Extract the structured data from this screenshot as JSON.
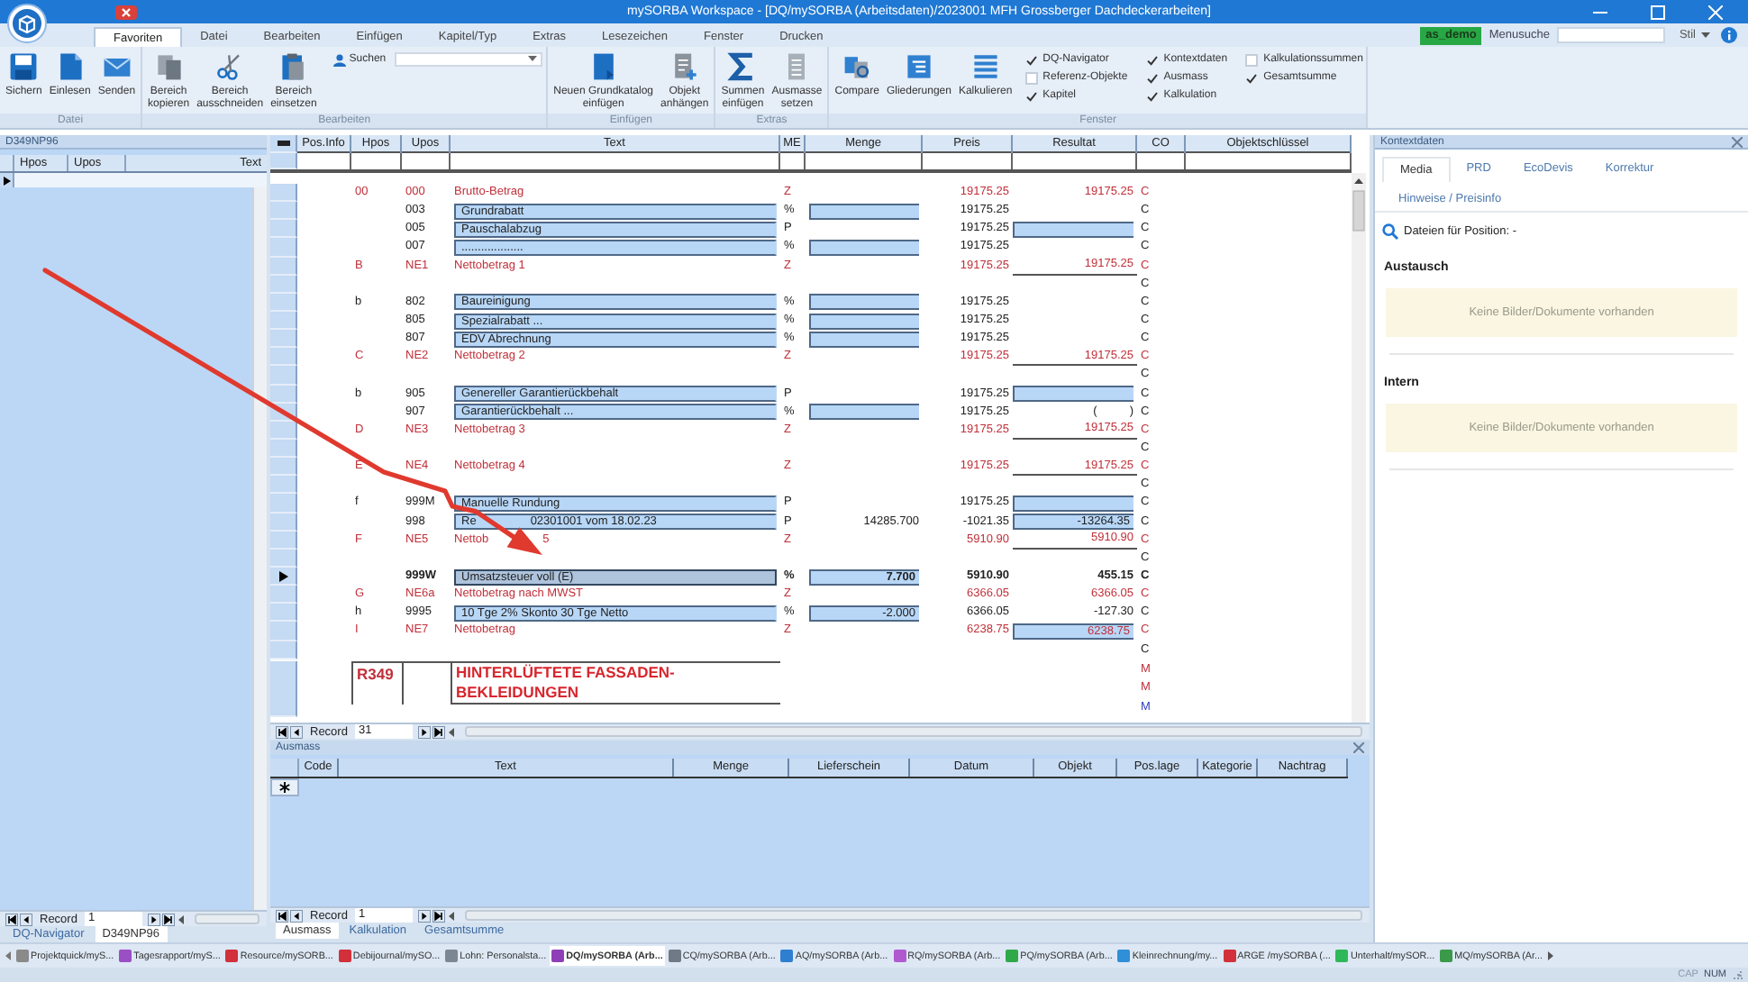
{
  "window": {
    "title": "mySORBA Workspace - [DQ/mySORBA (Arbeitsdaten)/2023001 MFH Grossberger Dachdeckerarbeiten]"
  },
  "menu_tabs": [
    {
      "label": "Favoriten",
      "selected": true
    },
    {
      "label": "Datei",
      "selected": false
    },
    {
      "label": "Bearbeiten",
      "selected": false
    },
    {
      "label": "Einfügen",
      "selected": false
    },
    {
      "label": "Kapitel/Typ",
      "selected": false
    },
    {
      "label": "Extras",
      "selected": false
    },
    {
      "label": "Lesezeichen",
      "selected": false
    },
    {
      "label": "Fenster",
      "selected": false
    },
    {
      "label": "Drucken",
      "selected": false
    }
  ],
  "user": "as_demo",
  "menu_search": {
    "label": "Menusuche"
  },
  "style_menu": "Stil",
  "ribbon_groups": [
    {
      "label": "Datei",
      "buttons": [
        {
          "label": "Sichern"
        },
        {
          "label": "Einlesen"
        },
        {
          "label": "Senden"
        }
      ]
    },
    {
      "label": "Bearbeiten",
      "buttons": [
        {
          "label": "Bereich\nkopieren"
        },
        {
          "label": "Bereich\nausschneiden"
        },
        {
          "label": "Bereich\neinsetzen"
        }
      ],
      "search": {
        "label": "Suchen"
      }
    },
    {
      "label": "Einfügen",
      "buttons": [
        {
          "label": "Neuen Grundkatalog\neinfügen"
        },
        {
          "label": "Objekt\nanhängen"
        }
      ]
    },
    {
      "label": "Extras",
      "buttons": [
        {
          "label": "Summen\neinfügen"
        },
        {
          "label": "Ausmasse\nsetzen"
        }
      ]
    },
    {
      "label": "Fenster",
      "buttons": [
        {
          "label": "Compare"
        },
        {
          "label": "Gliederungen"
        },
        {
          "label": "Kalkulieren"
        }
      ],
      "checkboxes": [
        {
          "label": "DQ-Navigator",
          "checked": true
        },
        {
          "label": "Referenz-Objekte",
          "checked": false
        },
        {
          "label": "Kapitel",
          "checked": true
        },
        {
          "label": "Kontextdaten",
          "checked": true
        },
        {
          "label": "Ausmass",
          "checked": true
        },
        {
          "label": "Kalkulation",
          "checked": true
        },
        {
          "label": "Kalkulationssummen",
          "checked": false
        },
        {
          "label": "Gesamtsumme",
          "checked": true
        }
      ]
    }
  ],
  "left_panel": {
    "title": "D349NP96",
    "columns": [
      "Hpos",
      "Upos",
      "Text"
    ],
    "record_nav": {
      "label": "Record",
      "value": "1"
    },
    "tabs": [
      {
        "label": "DQ-Navigator",
        "selected": false
      },
      {
        "label": "D349NP96",
        "selected": true
      }
    ]
  },
  "grid": {
    "columns": [
      "Pos.Info",
      "Hpos",
      "Upos",
      "Text",
      "ME",
      "Menge",
      "Preis",
      "Resultat",
      "CO",
      "Objektschlüssel"
    ],
    "rows": [
      {
        "kind": "total",
        "selected": false,
        "hpos": "00",
        "upos": "000",
        "text": "Brutto-Betrag",
        "me": "Z",
        "preis": "19175.25",
        "resultat": "19175.25",
        "co": "C"
      },
      {
        "kind": "input",
        "selected": false,
        "upos": "003",
        "text": "Grundrabatt",
        "me": "%",
        "menge_field": true,
        "preis": "19175.25",
        "co": "C"
      },
      {
        "kind": "input",
        "selected": false,
        "upos": "005",
        "text": "Pauschalabzug",
        "me": "P",
        "preis": "19175.25",
        "resultat_field": true,
        "co": "C"
      },
      {
        "kind": "input",
        "selected": false,
        "upos": "007",
        "text": "...................",
        "me": "%",
        "menge_field": true,
        "preis": "19175.25",
        "co": "C"
      },
      {
        "kind": "total",
        "selected": false,
        "hpos": "B",
        "upos": "NE1",
        "text": "Nettobetrag 1",
        "me": "Z",
        "preis": "19175.25",
        "resultat": "19175.25",
        "underlined": true,
        "co": "C"
      },
      {
        "kind": "blank",
        "selected": false,
        "co": "C"
      },
      {
        "kind": "input",
        "selected": false,
        "hpos": "b",
        "upos": "802",
        "text": "Baureinigung",
        "me": "%",
        "menge_field": true,
        "preis": "19175.25",
        "co": "C"
      },
      {
        "kind": "input",
        "selected": false,
        "upos": "805",
        "text": "Spezialrabatt ...",
        "me": "%",
        "menge_field": true,
        "preis": "19175.25",
        "co": "C"
      },
      {
        "kind": "input",
        "selected": false,
        "upos": "807",
        "text": "EDV Abrechnung",
        "me": "%",
        "menge_field": true,
        "preis": "19175.25",
        "co": "C"
      },
      {
        "kind": "total",
        "selected": false,
        "hpos": "C",
        "upos": "NE2",
        "text": "Nettobetrag 2",
        "me": "Z",
        "preis": "19175.25",
        "resultat": "19175.25",
        "underlined": true,
        "co": "C"
      },
      {
        "kind": "blank",
        "selected": false,
        "co": "C"
      },
      {
        "kind": "input",
        "selected": false,
        "hpos": "b",
        "upos": "905",
        "text": "Genereller Garantierückbehalt",
        "me": "P",
        "preis": "19175.25",
        "resultat_field": true,
        "co": "C"
      },
      {
        "kind": "input",
        "selected": false,
        "upos": "907",
        "text": "Garantierückbehalt ...",
        "me": "%",
        "menge_field": true,
        "preis": "19175.25",
        "resultat": "(          )",
        "co": "C"
      },
      {
        "kind": "total",
        "selected": false,
        "hpos": "D",
        "upos": "NE3",
        "text": "Nettobetrag 3",
        "me": "Z",
        "preis": "19175.25",
        "resultat": "19175.25",
        "underlined": true,
        "co": "C"
      },
      {
        "kind": "blank",
        "selected": false,
        "co": "C"
      },
      {
        "kind": "total",
        "selected": false,
        "hpos": "E",
        "upos": "NE4",
        "text": "Nettobetrag 4",
        "me": "Z",
        "preis": "19175.25",
        "resultat": "19175.25",
        "underlined": true,
        "co": "C"
      },
      {
        "kind": "blank",
        "selected": false,
        "co": "C"
      },
      {
        "kind": "input",
        "selected": false,
        "hpos": "f",
        "upos": "999M",
        "text": "Manuelle Rundung",
        "me": "P",
        "preis": "19175.25",
        "resultat_field": true,
        "co": "C"
      },
      {
        "kind": "input",
        "selected": false,
        "upos": "998",
        "text_pieces": [
          "Re",
          "02301001 vom 18.02.23"
        ],
        "me": "P",
        "menge": "14285.700",
        "preis": "-1021.35",
        "resultat": "-13264.35",
        "resultat_field": true,
        "co": "C"
      },
      {
        "kind": "total",
        "selected": false,
        "hpos": "F",
        "upos": "NE5",
        "text_pieces": [
          "Nettob",
          "5"
        ],
        "me": "Z",
        "preis": "5910.90",
        "resultat": "5910.90",
        "underlined": true,
        "co": "C"
      },
      {
        "kind": "blank",
        "selected": false,
        "co": "C"
      },
      {
        "kind": "current",
        "selected": true,
        "upos": "999W",
        "text": "Umsatzsteuer voll (E)",
        "me": "%",
        "menge": "7.700",
        "menge_field": true,
        "preis": "5910.90",
        "resultat": "455.15",
        "co": "C"
      },
      {
        "kind": "total",
        "selected": false,
        "hpos": "G",
        "upos": "NE6a",
        "text": "Nettobetrag nach MWST",
        "me": "Z",
        "preis": "6366.05",
        "resultat": "6366.05",
        "co": "C"
      },
      {
        "kind": "input",
        "selected": false,
        "hpos": "h",
        "upos": "9995",
        "text": "10 Tge 2% Skonto 30 Tge Netto",
        "me": "%",
        "menge": "-2.000",
        "menge_field": true,
        "preis": "6366.05",
        "resultat": "-127.30",
        "co": "C"
      },
      {
        "kind": "total",
        "selected": false,
        "hpos": "I",
        "upos": "NE7",
        "text": "Nettobetrag",
        "me": "Z",
        "preis": "6238.75",
        "resultat": "6238.75",
        "resultat_field": true,
        "co": "C"
      },
      {
        "kind": "blank",
        "selected": false,
        "co": "C"
      },
      {
        "kind": "heading",
        "selected": false,
        "hpos": "R349",
        "text": "HINTERLÜFTETE FASSADEN-\nBEKLEIDUNGEN",
        "co": "M\nM"
      },
      {
        "kind": "mark",
        "selected": false,
        "co": "M"
      }
    ],
    "record_nav": {
      "label": "Record",
      "value": "31"
    }
  },
  "ausmass": {
    "title": "Ausmass",
    "columns": [
      "Code",
      "Text",
      "Menge",
      "Lieferschein",
      "Datum",
      "Objekt",
      "Pos.lage",
      "Kategorie",
      "Nachtrag"
    ],
    "record_nav": {
      "label": "Record",
      "value": "1"
    },
    "tabs": [
      {
        "label": "Ausmass",
        "selected": true
      },
      {
        "label": "Kalkulation",
        "selected": false
      },
      {
        "label": "Gesamtsumme",
        "selected": false
      }
    ]
  },
  "context": {
    "title": "Kontextdaten",
    "tabs": [
      {
        "label": "Media",
        "selected": true
      },
      {
        "label": "PRD",
        "selected": false
      },
      {
        "label": "EcoDevis",
        "selected": false
      },
      {
        "label": "Korrektur",
        "selected": false
      },
      {
        "label": "Hinweise / Preisinfo",
        "selected": false
      }
    ],
    "position_label": "Dateien für Position: -",
    "sections": [
      {
        "title": "Austausch",
        "empty_text": "Keine Bilder/Dokumente vorhanden"
      },
      {
        "title": "Intern",
        "empty_text": "Keine Bilder/Dokumente vorhanden"
      }
    ]
  },
  "taskbar": [
    {
      "label": "Projektquick/myS...",
      "color": "#8a8a8a",
      "selected": false
    },
    {
      "label": "Tagesrapport/myS...",
      "color": "#9b4fc4",
      "selected": false
    },
    {
      "label": "Resource/mySORB...",
      "color": "#d2303a",
      "selected": false
    },
    {
      "label": "Debijournal/mySO...",
      "color": "#d2303a",
      "selected": false
    },
    {
      "label": "Lohn: Personalsta...",
      "color": "#7c8794",
      "selected": false
    },
    {
      "label": "DQ/mySORBA (Arb...",
      "color": "#8e3fb8",
      "selected": true
    },
    {
      "label": "CQ/mySORBA (Arb...",
      "color": "#6f7a86",
      "selected": false
    },
    {
      "label": "AQ/mySORBA (Arb...",
      "color": "#2f7fd0",
      "selected": false
    },
    {
      "label": "RQ/mySORBA (Arb...",
      "color": "#b05ad0",
      "selected": false
    },
    {
      "label": "PQ/mySORBA (Arb...",
      "color": "#2fa84a",
      "selected": false
    },
    {
      "label": "Kleinrechnung/my...",
      "color": "#2f8fd8",
      "selected": false
    },
    {
      "label": "ARGE /mySORBA (...",
      "color": "#d2303a",
      "selected": false
    },
    {
      "label": "Unterhalt/mySOR...",
      "color": "#2fb85a",
      "selected": false
    },
    {
      "label": "MQ/mySORBA (Ar...",
      "color": "#3a9a4a",
      "selected": false
    }
  ],
  "status_bar": [
    "CAP",
    "NUM"
  ]
}
